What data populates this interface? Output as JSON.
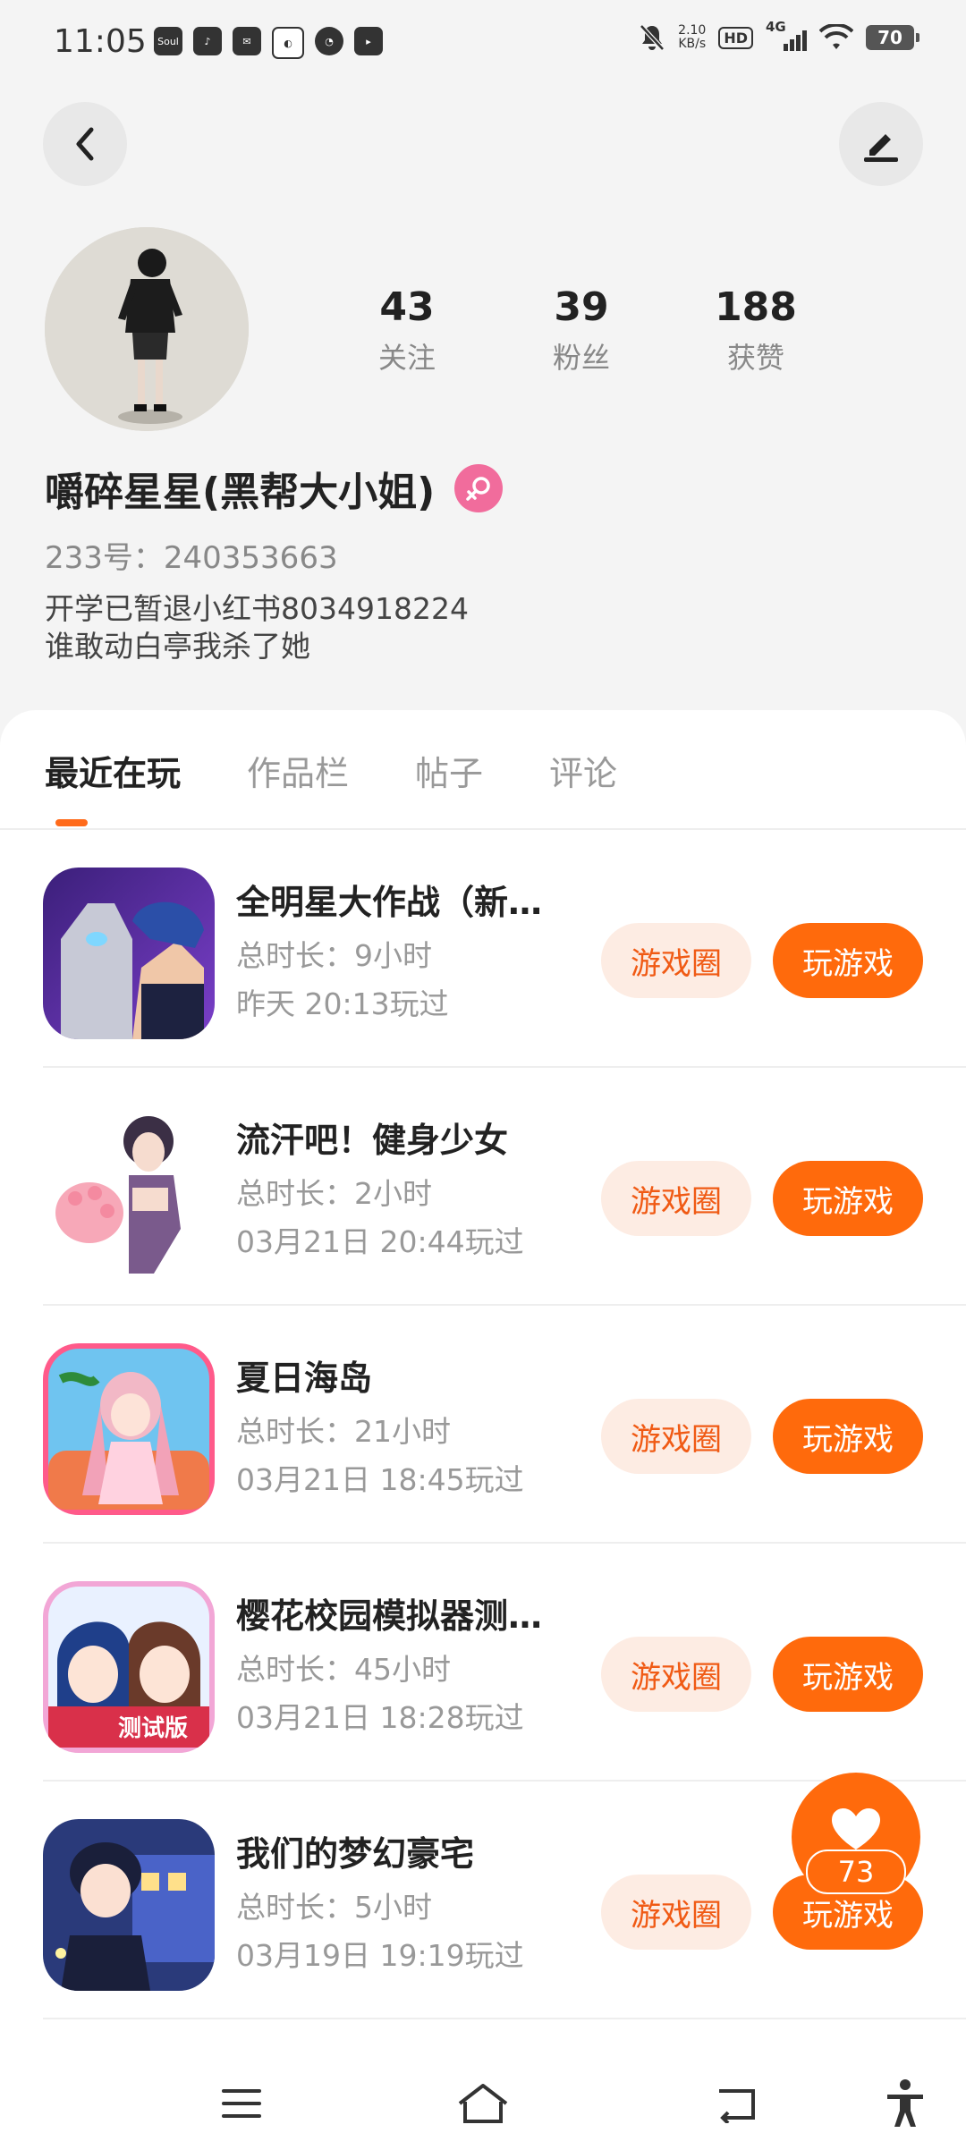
{
  "status_bar": {
    "time": "11:05",
    "net_speed_value": "2.10",
    "net_speed_unit": "KB/s",
    "hd": "HD",
    "network": "4G",
    "battery": "70",
    "app_soul": "Soul"
  },
  "profile": {
    "following_count": "43",
    "following_label": "关注",
    "followers_count": "39",
    "followers_label": "粉丝",
    "likes_count": "188",
    "likes_label": "获赞",
    "nickname": "嚼碎星星(黑帮大小姐)",
    "user_id": "233号：240353663",
    "bio_line1": "开学已暂退小红书8034918224",
    "bio_line2": "谁敢动白亭我杀了她"
  },
  "tabs": [
    "最近在玩",
    "作品栏",
    "帖子",
    "评论"
  ],
  "games": [
    {
      "title": "全明星大作战（新…",
      "duration": "总时长：9小时",
      "last_played": "昨天 20:13玩过",
      "circle_label": "游戏圈",
      "play_label": "玩游戏"
    },
    {
      "title": "流汗吧！健身少女",
      "duration": "总时长：2小时",
      "last_played": "03月21日 20:44玩过",
      "circle_label": "游戏圈",
      "play_label": "玩游戏"
    },
    {
      "title": "夏日海岛",
      "duration": "总时长：21小时",
      "last_played": "03月21日 18:45玩过",
      "circle_label": "游戏圈",
      "play_label": "玩游戏"
    },
    {
      "title": "樱花校园模拟器测…",
      "duration": "总时长：45小时",
      "last_played": "03月21日 18:28玩过",
      "circle_label": "游戏圈",
      "play_label": "玩游戏"
    },
    {
      "title": "我们的梦幻豪宅",
      "duration": "总时长：5小时",
      "last_played": "03月19日 19:19玩过",
      "circle_label": "游戏圈",
      "play_label": "玩游戏"
    }
  ],
  "game_icon_texts": {
    "sakura_badge": "测试版"
  },
  "like_fab": {
    "count": "73"
  },
  "colors": {
    "accent": "#ff6a0c",
    "accent_soft": "#fdece3",
    "gender_badge": "#f16c9c"
  }
}
